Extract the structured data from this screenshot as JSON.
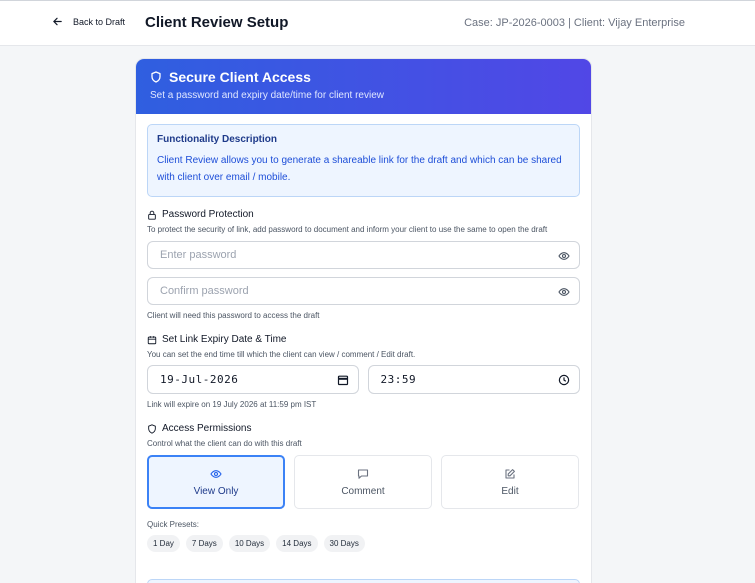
{
  "header": {
    "back_label": "Back to Draft",
    "title": "Client Review Setup",
    "case_info": "Case: JP-2026-0003 | Client: Vijay Enterprise"
  },
  "card": {
    "title": "Secure Client Access",
    "subtitle": "Set a password and expiry date/time for client review",
    "accent_gradient": [
      "#2f5fe0",
      "#5147e6"
    ]
  },
  "description": {
    "heading": "Functionality Description",
    "text": "Client Review allows you to generate a shareable link for the draft and which can be shared with client over email / mobile."
  },
  "password": {
    "title": "Password Protection",
    "subtitle": "To protect the security of link, add password to document and inform your client to use the same to open the draft",
    "password_placeholder": "Enter password",
    "confirm_placeholder": "Confirm password",
    "hint": "Client will need this password to access the draft"
  },
  "expiry": {
    "title": "Set Link Expiry Date & Time",
    "subtitle": "You can set the end time till which the client can view / comment / Edit draft.",
    "date_value": "19-Jul-2026",
    "time_value": "23:59",
    "hint": "Link will expire on 19 July 2026 at 11:59 pm IST"
  },
  "permissions": {
    "title": "Access Permissions",
    "subtitle": "Control what the client can do with this draft",
    "options": [
      {
        "label": "View Only",
        "icon": "eye-icon",
        "selected": true
      },
      {
        "label": "Comment",
        "icon": "comment-icon",
        "selected": false
      },
      {
        "label": "Edit",
        "icon": "edit-icon",
        "selected": false
      }
    ]
  },
  "presets": {
    "label": "Quick Presets:",
    "items": [
      "1 Day",
      "7 Days",
      "10 Days",
      "14 Days",
      "30 Days"
    ]
  }
}
